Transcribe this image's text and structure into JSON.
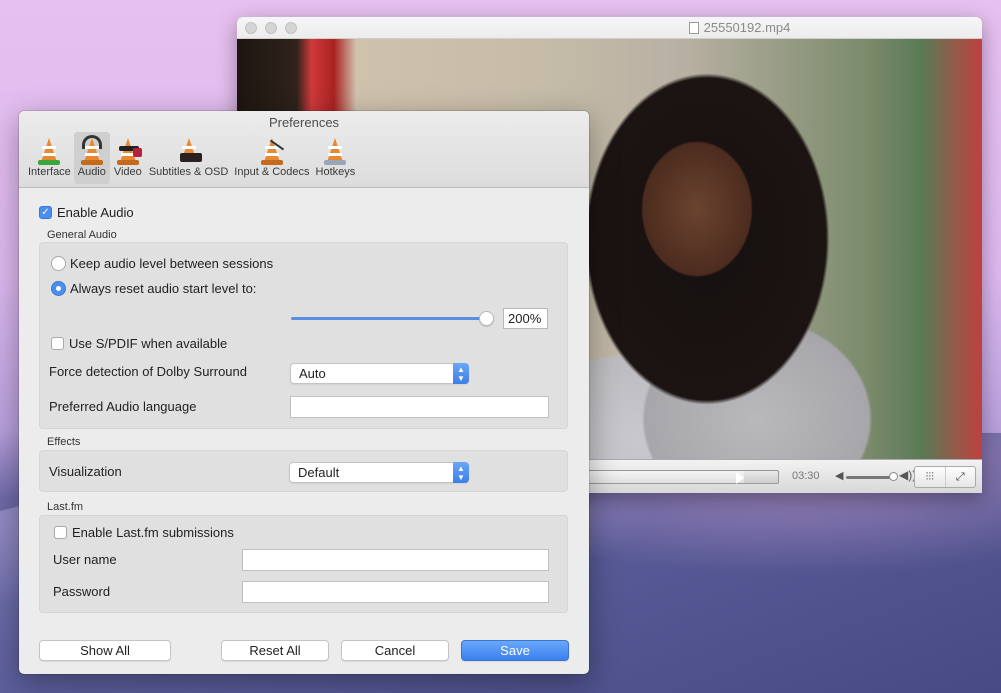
{
  "player": {
    "title": "25550192.mp4",
    "time": "03:30",
    "progress_fraction": 0.83,
    "volume_fraction": 1.0,
    "equalizer_label": "⫶⫶⫶",
    "fullscreen_label": "⤢"
  },
  "prefs": {
    "title": "Preferences",
    "tabs": [
      {
        "label": "Interface",
        "icon": "vlc-cone-interface-icon"
      },
      {
        "label": "Audio",
        "icon": "vlc-cone-headphones-icon",
        "active": true
      },
      {
        "label": "Video",
        "icon": "vlc-cone-glasses-icon"
      },
      {
        "label": "Subtitles & OSD",
        "icon": "vlc-cone-subtitles-icon"
      },
      {
        "label": "Input & Codecs",
        "icon": "vlc-cone-cables-icon"
      },
      {
        "label": "Hotkeys",
        "icon": "vlc-cone-keyboard-icon"
      }
    ],
    "enable_audio": {
      "label": "Enable Audio",
      "checked": true
    },
    "general_audio": {
      "section_label": "General Audio",
      "keep_level": {
        "label": "Keep audio level between sessions",
        "selected": false
      },
      "reset_level": {
        "label": "Always reset audio start level to:",
        "selected": true
      },
      "level_value": "200%",
      "level_fraction": 1.0,
      "spdif": {
        "label": "Use S/PDIF when available",
        "checked": false
      },
      "dolby_label": "Force detection of Dolby Surround",
      "dolby_value": "Auto",
      "language_label": "Preferred Audio language",
      "language_value": ""
    },
    "effects": {
      "section_label": "Effects",
      "visualization_label": "Visualization",
      "visualization_value": "Default"
    },
    "lastfm": {
      "section_label": "Last.fm",
      "enable": {
        "label": "Enable Last.fm submissions",
        "checked": false
      },
      "username_label": "User name",
      "username_value": "",
      "password_label": "Password",
      "password_value": ""
    },
    "buttons": {
      "show_all": "Show All",
      "reset_all": "Reset All",
      "cancel": "Cancel",
      "save": "Save"
    }
  },
  "colors": {
    "accent": "#4a8ef0",
    "slider": "#5b8ee0",
    "desktop": "#e6c0ef"
  }
}
